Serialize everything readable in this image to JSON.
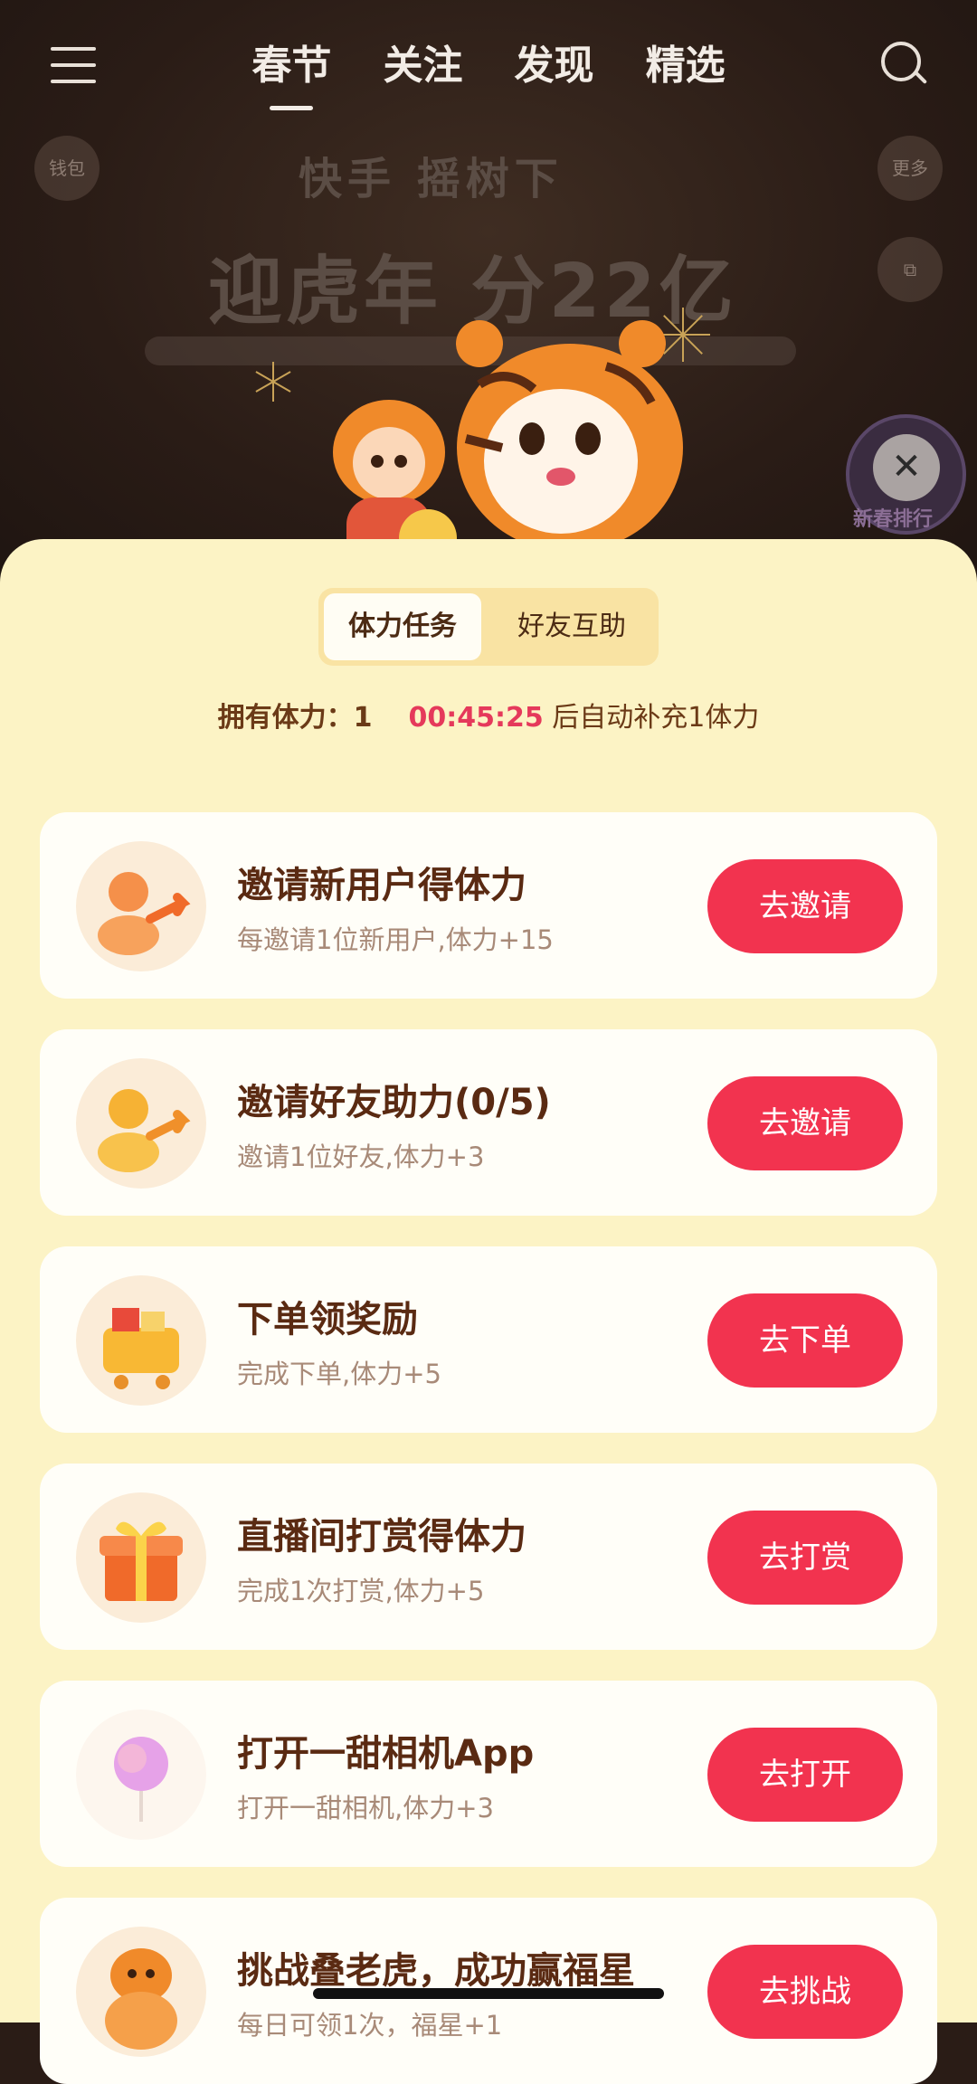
{
  "top_nav": {
    "tabs": [
      {
        "label": "春节",
        "active": true
      },
      {
        "label": "关注",
        "active": false
      },
      {
        "label": "发现",
        "active": false
      },
      {
        "label": "精选",
        "active": false
      }
    ],
    "menu_icon": "hamburger-icon",
    "search_icon": "search-icon"
  },
  "banner": {
    "left_button": "钱包",
    "right_button": "更多",
    "brand": "快手 摇树下",
    "title": "迎虎年 分22亿",
    "badge": "新春排行"
  },
  "panel": {
    "segments": [
      {
        "label": "体力任务",
        "active": true
      },
      {
        "label": "好友互助",
        "active": false
      }
    ],
    "stamina_label": "拥有体力：",
    "stamina_value": "1",
    "countdown": "00:45:25",
    "refill_text": " 后自动补充1体力"
  },
  "tasks": [
    {
      "title": "邀请新用户得体力",
      "desc": "每邀请1位新用户,体力+15",
      "button": "去邀请",
      "icon": "invite-user-icon"
    },
    {
      "title": "邀请好友助力(0/5)",
      "desc": "邀请1位好友,体力+3",
      "button": "去邀请",
      "icon": "invite-friend-icon"
    },
    {
      "title": "下单领奖励",
      "desc": "完成下单,体力+5",
      "button": "去下单",
      "icon": "shopping-cart-icon"
    },
    {
      "title": "直播间打赏得体力",
      "desc": "完成1次打赏,体力+5",
      "button": "去打赏",
      "icon": "gift-box-icon"
    },
    {
      "title": "打开一甜相机App",
      "desc": "打开一甜相机,体力+3",
      "button": "去打开",
      "icon": "cotton-candy-icon"
    },
    {
      "title": "挑战叠老虎，成功赢福星",
      "desc": "每日可领1次，福星+1",
      "button": "去挑战",
      "icon": "stacked-tiger-icon"
    }
  ],
  "colors": {
    "accent": "#f2334f",
    "panel_bg": "#fcf3c5",
    "countdown": "#e5395b"
  }
}
